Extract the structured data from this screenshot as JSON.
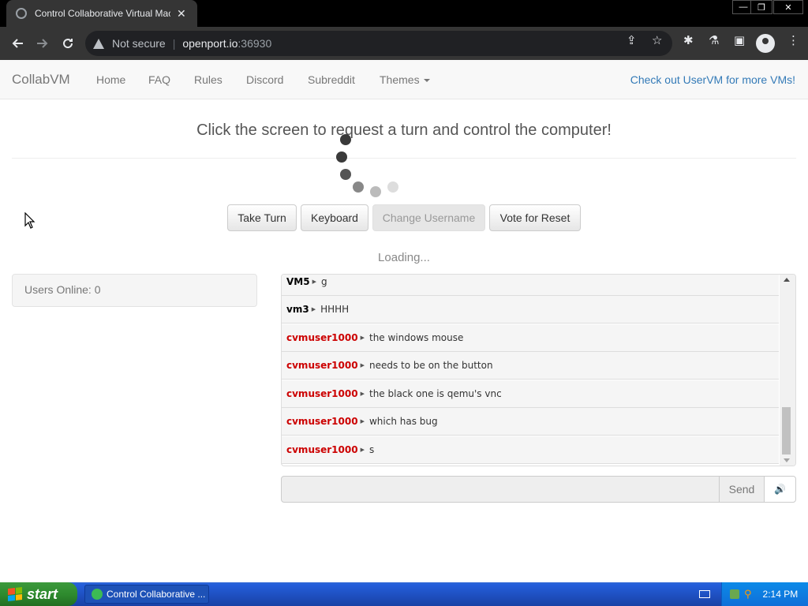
{
  "browser": {
    "tab_title": "Control Collaborative Virtual Machine",
    "tab_close": "✕",
    "security_label": "Not secure",
    "url_host": "openport.io",
    "url_port": ":36930",
    "window_controls": [
      "—",
      "❐",
      "✕"
    ]
  },
  "navbar": {
    "brand": "CollabVM",
    "items": [
      "Home",
      "FAQ",
      "Rules",
      "Discord",
      "Subreddit",
      "Themes"
    ],
    "right_link": "Check out UserVM for more VMs!"
  },
  "main": {
    "headline": "Click the screen to request a turn and control the computer!",
    "buttons": {
      "take_turn": "Take Turn",
      "keyboard": "Keyboard",
      "change_username": "Change Username",
      "vote_reset": "Vote for Reset"
    },
    "loading_text": "Loading...",
    "users_online": "Users Online: 0"
  },
  "chat": {
    "messages": [
      {
        "user": "VM5",
        "text": "g",
        "type": "vm"
      },
      {
        "user": "vm3",
        "text": "HHHH",
        "type": "vm"
      },
      {
        "user": "cvmuser1000",
        "text": "the windows mouse",
        "type": "guest"
      },
      {
        "user": "cvmuser1000",
        "text": "needs to be on the button",
        "type": "guest"
      },
      {
        "user": "cvmuser1000",
        "text": "the black one is qemu's vnc",
        "type": "guest"
      },
      {
        "user": "cvmuser1000",
        "text": "which has bug",
        "type": "guest"
      },
      {
        "user": "cvmuser1000",
        "text": "s",
        "type": "guest"
      }
    ],
    "input_value": "",
    "send_label": "Send",
    "volume_icon": "🔊"
  },
  "taskbar": {
    "start_label": "start",
    "task_title": "Control Collaborative ...",
    "clock": "2:14 PM"
  },
  "colors": {
    "guest_user": "#cc0000",
    "link": "#337ab7",
    "taskbar": "#245edb"
  }
}
